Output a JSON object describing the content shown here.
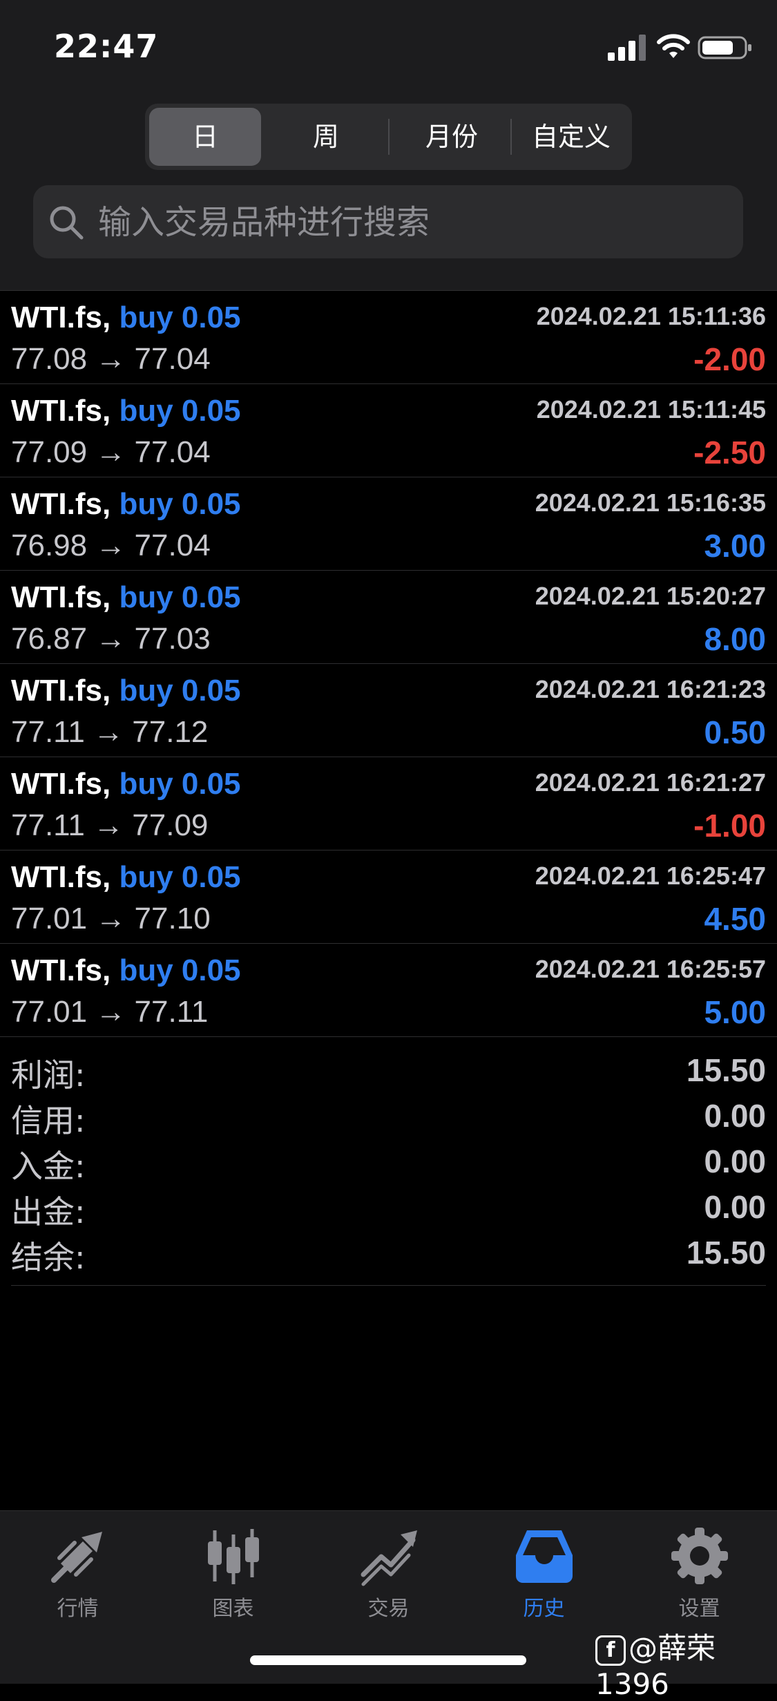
{
  "status_bar": {
    "time": "22:47"
  },
  "period_tabs": [
    {
      "label": "日",
      "active": true
    },
    {
      "label": "周",
      "active": false
    },
    {
      "label": "月份",
      "active": false
    },
    {
      "label": "自定义",
      "active": false
    }
  ],
  "search": {
    "placeholder": "输入交易品种进行搜索"
  },
  "trades": [
    {
      "symbol": "WTI.fs,",
      "side": "buy 0.05",
      "time": "2024.02.21 15:11:36",
      "prices": "77.08 → 77.04",
      "profit": "-2.00"
    },
    {
      "symbol": "WTI.fs,",
      "side": "buy 0.05",
      "time": "2024.02.21 15:11:45",
      "prices": "77.09 → 77.04",
      "profit": "-2.50"
    },
    {
      "symbol": "WTI.fs,",
      "side": "buy 0.05",
      "time": "2024.02.21 15:16:35",
      "prices": "76.98 → 77.04",
      "profit": "3.00"
    },
    {
      "symbol": "WTI.fs,",
      "side": "buy 0.05",
      "time": "2024.02.21 15:20:27",
      "prices": "76.87 → 77.03",
      "profit": "8.00"
    },
    {
      "symbol": "WTI.fs,",
      "side": "buy 0.05",
      "time": "2024.02.21 16:21:23",
      "prices": "77.11 → 77.12",
      "profit": "0.50"
    },
    {
      "symbol": "WTI.fs,",
      "side": "buy 0.05",
      "time": "2024.02.21 16:21:27",
      "prices": "77.11 → 77.09",
      "profit": "-1.00"
    },
    {
      "symbol": "WTI.fs,",
      "side": "buy 0.05",
      "time": "2024.02.21 16:25:47",
      "prices": "77.01 → 77.10",
      "profit": "4.50"
    },
    {
      "symbol": "WTI.fs,",
      "side": "buy 0.05",
      "time": "2024.02.21 16:25:57",
      "prices": "77.01 → 77.11",
      "profit": "5.00"
    }
  ],
  "summary": [
    {
      "label": "利润:",
      "value": "15.50"
    },
    {
      "label": "信用:",
      "value": "0.00"
    },
    {
      "label": "入金:",
      "value": "0.00"
    },
    {
      "label": "出金:",
      "value": "0.00"
    },
    {
      "label": "结余:",
      "value": "15.50"
    }
  ],
  "tab_bar": [
    {
      "label": "行情",
      "icon": "quotes-icon",
      "active": false
    },
    {
      "label": "图表",
      "icon": "chart-icon",
      "active": false
    },
    {
      "label": "交易",
      "icon": "trade-icon",
      "active": false
    },
    {
      "label": "历史",
      "icon": "history-icon",
      "active": true
    },
    {
      "label": "设置",
      "icon": "settings-icon",
      "active": false
    }
  ],
  "watermark": {
    "text": "@薛荣1396",
    "logo": "f"
  },
  "colors": {
    "accent": "#2f7ef0",
    "loss": "#e8433b",
    "header_bg": "#1c1c1e",
    "body_bg": "#000000"
  }
}
